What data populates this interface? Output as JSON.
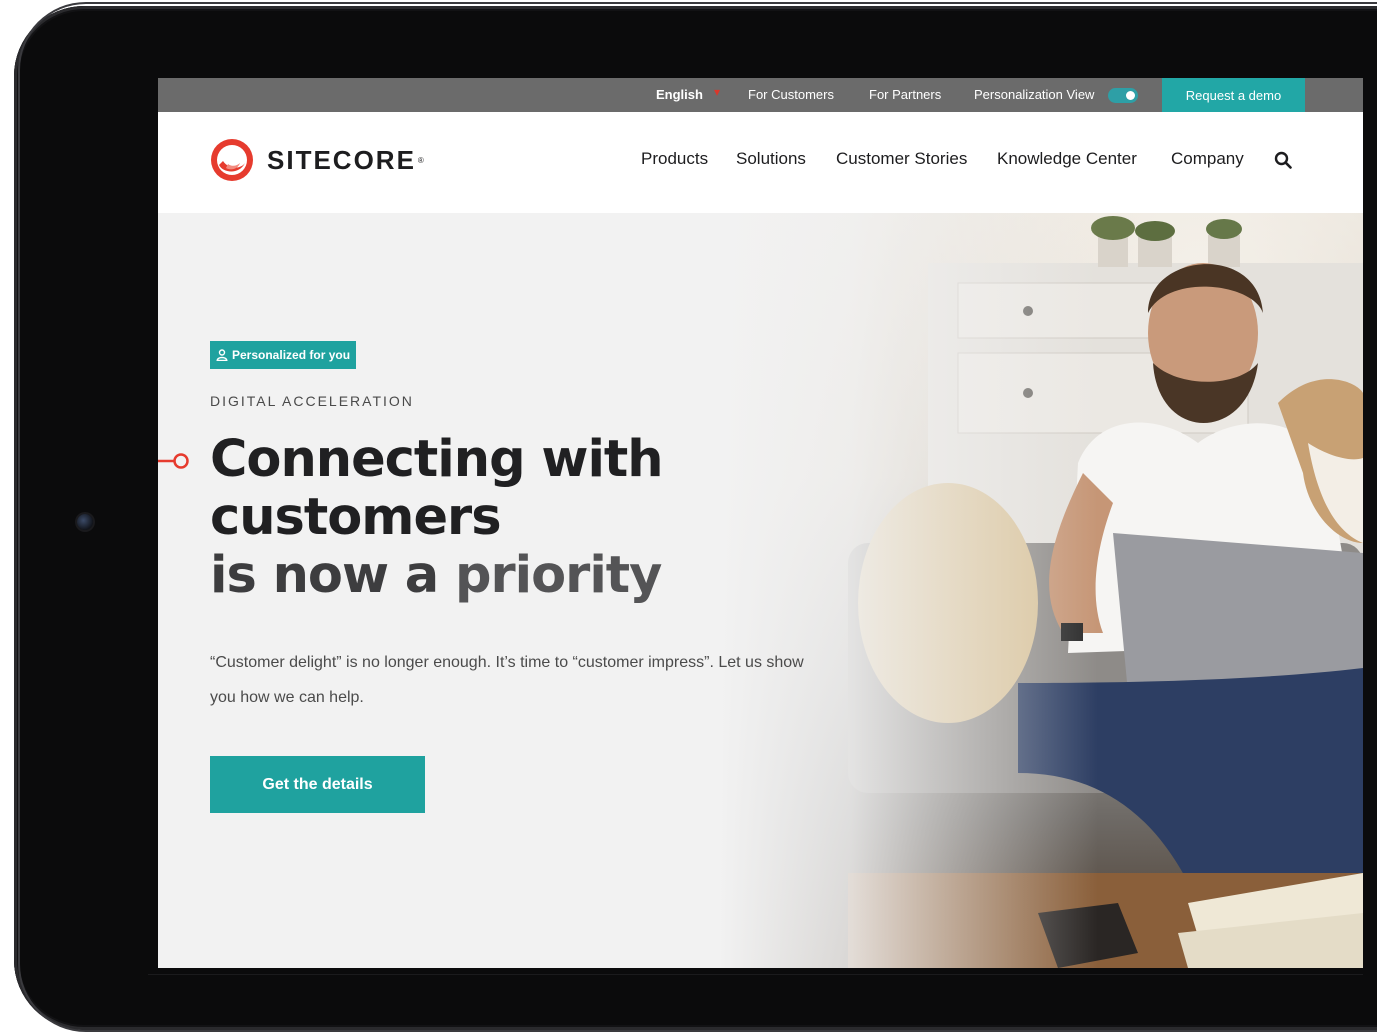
{
  "topbar": {
    "language": "English",
    "for_customers": "For Customers",
    "for_partners": "For Partners",
    "personalization_view": "Personalization View",
    "personalization_toggle_on": true,
    "request_demo": "Request a demo"
  },
  "header": {
    "logo_text": "SITECORE",
    "logo_tm": "®",
    "nav": [
      "Products",
      "Solutions",
      "Customer Stories",
      "Knowledge Center",
      "Company"
    ]
  },
  "hero": {
    "tag": "Personalized for you",
    "eyebrow": "DIGITAL ACCELERATION",
    "headline_line1": "Connecting with",
    "headline_line2": "customers",
    "headline_line3_prefix": "is now a ",
    "headline_line3_accent": "priority",
    "body": "“Customer delight” is no longer enough. It’s time to “customer impress”. Let us show you how we can help.",
    "cta": "Get the details"
  },
  "colors": {
    "teal": "#1fa29f",
    "topbar_gray": "#6b6b6b",
    "brand_red": "#e63b2e",
    "text_dark": "#202022"
  },
  "icons": {
    "search": "search-icon",
    "user": "user-icon",
    "caret": "chevron-down-icon",
    "logo": "sitecore-logo-icon"
  }
}
